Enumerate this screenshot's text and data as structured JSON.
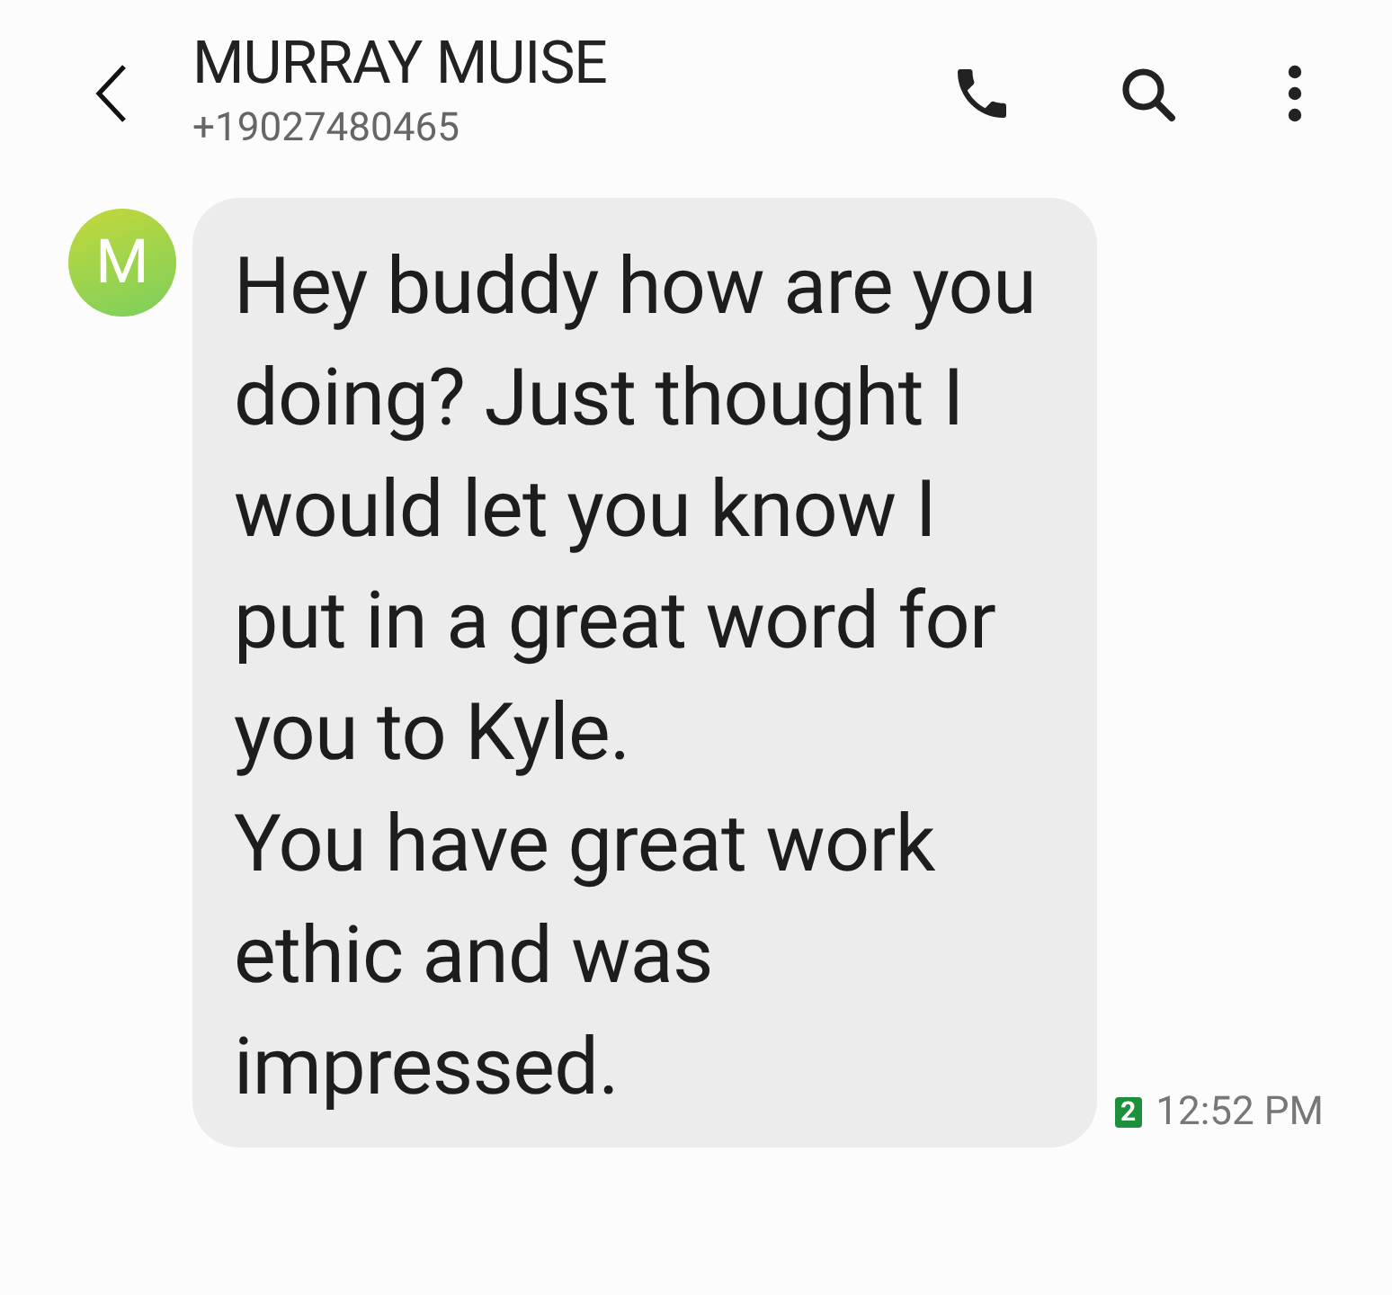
{
  "header": {
    "name": "MURRAY MUISE",
    "phone": "+19027480465"
  },
  "messages": [
    {
      "avatar_letter": "M",
      "text": "Hey buddy how are you doing? Just thought I would let you know I put in a great word for you to Kyle.\nYou have great work ethic and was impressed.",
      "sim": "2",
      "time": "12:52 PM"
    }
  ]
}
